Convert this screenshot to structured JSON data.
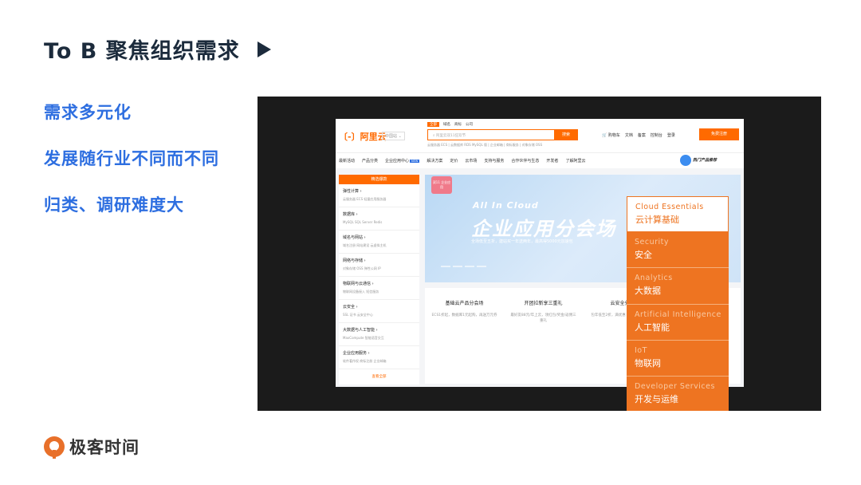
{
  "slide": {
    "title": "To B 聚焦组织需求",
    "points": [
      "需求多元化",
      "发展随行业不同而不同",
      "归类、调研难度大"
    ],
    "footer_logo": "极客时间"
  },
  "screenshot": {
    "logo": "〔-〕阿里云",
    "region": "中国站 ⌄",
    "search_tabs": [
      "全部",
      "域名",
      "商标",
      "公司"
    ],
    "search_placeholder": "阿里云双11狂欢节",
    "search_button": "搜索",
    "hot_words": "云服务器 ECS | 云数据库 RDS MySQL 版 | 企业邮箱 | 商标服务 | 对象存储 OSS",
    "top_links": [
      "🛒 购物车",
      "文档",
      "备案",
      "控制台",
      "登录"
    ],
    "signup": "免费注册",
    "nav": [
      "最新活动",
      "产品分类",
      "企业应用中心",
      "解决方案",
      "定价",
      "云市场",
      "支持与服务",
      "合作伙伴与生态",
      "开发者",
      "了解阿里云"
    ],
    "nav_new_badge": "NEW",
    "nav_promo": "热门产品推荐",
    "sidebar_head": "精选爆款",
    "sidebar": [
      {
        "title": "弹性计算 ›",
        "sub": "云服务器 ECS  轻量应用服务器"
      },
      {
        "title": "数据库 ›",
        "sub": "MySQL  SQL Server  Redis"
      },
      {
        "title": "域名与网站 ›",
        "sub": "域名注册  网站建设  云虚拟主机"
      },
      {
        "title": "网络与存储 ›",
        "sub": "对象存储 OSS  弹性公网 IP"
      },
      {
        "title": "物联网与云通信 ›",
        "sub": "物联网设备接入  短信服务"
      },
      {
        "title": "云安全 ›",
        "sub": "SSL 证书  云安全中心"
      },
      {
        "title": "大数据与人工智能 ›",
        "sub": "MaxCompute  智能语音交互"
      },
      {
        "title": "企业应用服务 ›",
        "sub": "软件著作权  商标注册  企业邮箱"
      }
    ],
    "sidebar_more": "查看全部",
    "banner": {
      "tag": "双11 企业应用",
      "line1": "All In Cloud",
      "line2": "企业应用分会场",
      "line3": "全场低至五折，建站买一年送两年，最高得5000元加速包"
    },
    "cards": [
      {
        "title": "基础云产品分会场",
        "sub": "ECS1折起，数据库1元起购，再送万元券"
      },
      {
        "title": "开团拉新享三重礼",
        "sub": "最好友88元/年上云，领红包/奖金/返佣三重礼"
      },
      {
        "title": "云安全分会",
        "sub": "包年低至2折，满优惠 5000、400元代"
      },
      {
        "title": "",
        "sub": ""
      }
    ]
  },
  "menu": [
    {
      "en": "Cloud Essentials",
      "zh": "云计算基础"
    },
    {
      "en": "Security",
      "zh": "安全"
    },
    {
      "en": "Analytics",
      "zh": "大数据"
    },
    {
      "en": "Artificial Intelligence",
      "zh": "人工智能"
    },
    {
      "en": "IoT",
      "zh": "物联网"
    },
    {
      "en": "Developer Services",
      "zh": "开发与运维"
    }
  ],
  "colors": {
    "accent_blue": "#2d6ee0",
    "aliyun_orange": "#ff6a00",
    "menu_orange": "#ee7421"
  }
}
